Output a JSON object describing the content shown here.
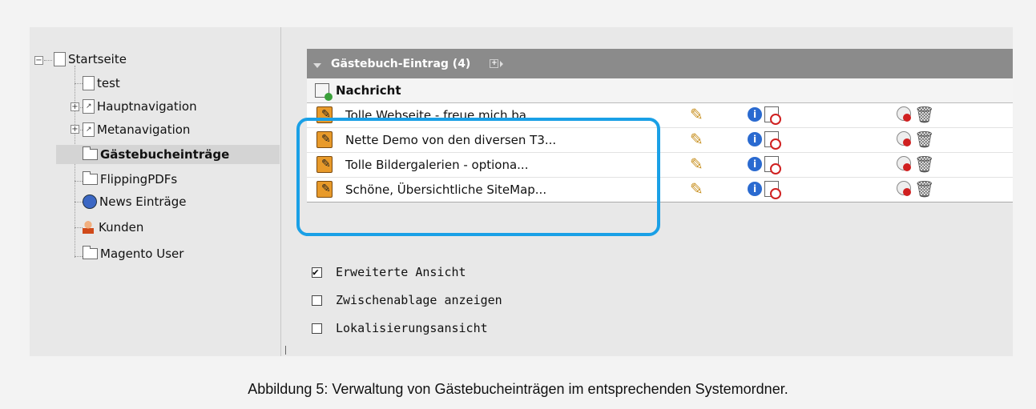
{
  "tree": {
    "root": "Startseite",
    "items": [
      {
        "label": "test"
      },
      {
        "label": "Hauptnavigation"
      },
      {
        "label": "Metanavigation"
      },
      {
        "label": "Gästebucheinträge",
        "selected": true
      },
      {
        "label": "FlippingPDFs"
      },
      {
        "label": "News Einträge"
      },
      {
        "label": "Kunden"
      },
      {
        "label": "Magento User"
      }
    ]
  },
  "panel": {
    "header_title": "Gästebuch-Eintrag (4)",
    "column_header": "Nachricht",
    "rows": [
      {
        "label": "Tolle Webseite - freue mich ba..."
      },
      {
        "label": "Nette Demo von den diversen T3..."
      },
      {
        "label": "Tolle Bildergalerien - optiona..."
      },
      {
        "label": "Schöne, Übersichtliche SiteMap..."
      }
    ]
  },
  "options": {
    "extended_view": {
      "label": "Erweiterte Ansicht",
      "checked": true
    },
    "clipboard": {
      "label": "Zwischenablage anzeigen",
      "checked": false
    },
    "localization": {
      "label": "Lokalisierungsansicht",
      "checked": false
    }
  },
  "caption": "Abbildung 5: Verwaltung von Gästebucheinträgen im entsprechenden Systemordner.",
  "colors": {
    "highlight": "#1aa0e6",
    "panel_header": "#8b8b8b",
    "selected_row": "#d4d4d4"
  },
  "icons": {
    "edit": "pencil-icon",
    "info": "info-icon",
    "history": "history-icon",
    "hide": "hide-icon",
    "delete": "trash-icon"
  }
}
